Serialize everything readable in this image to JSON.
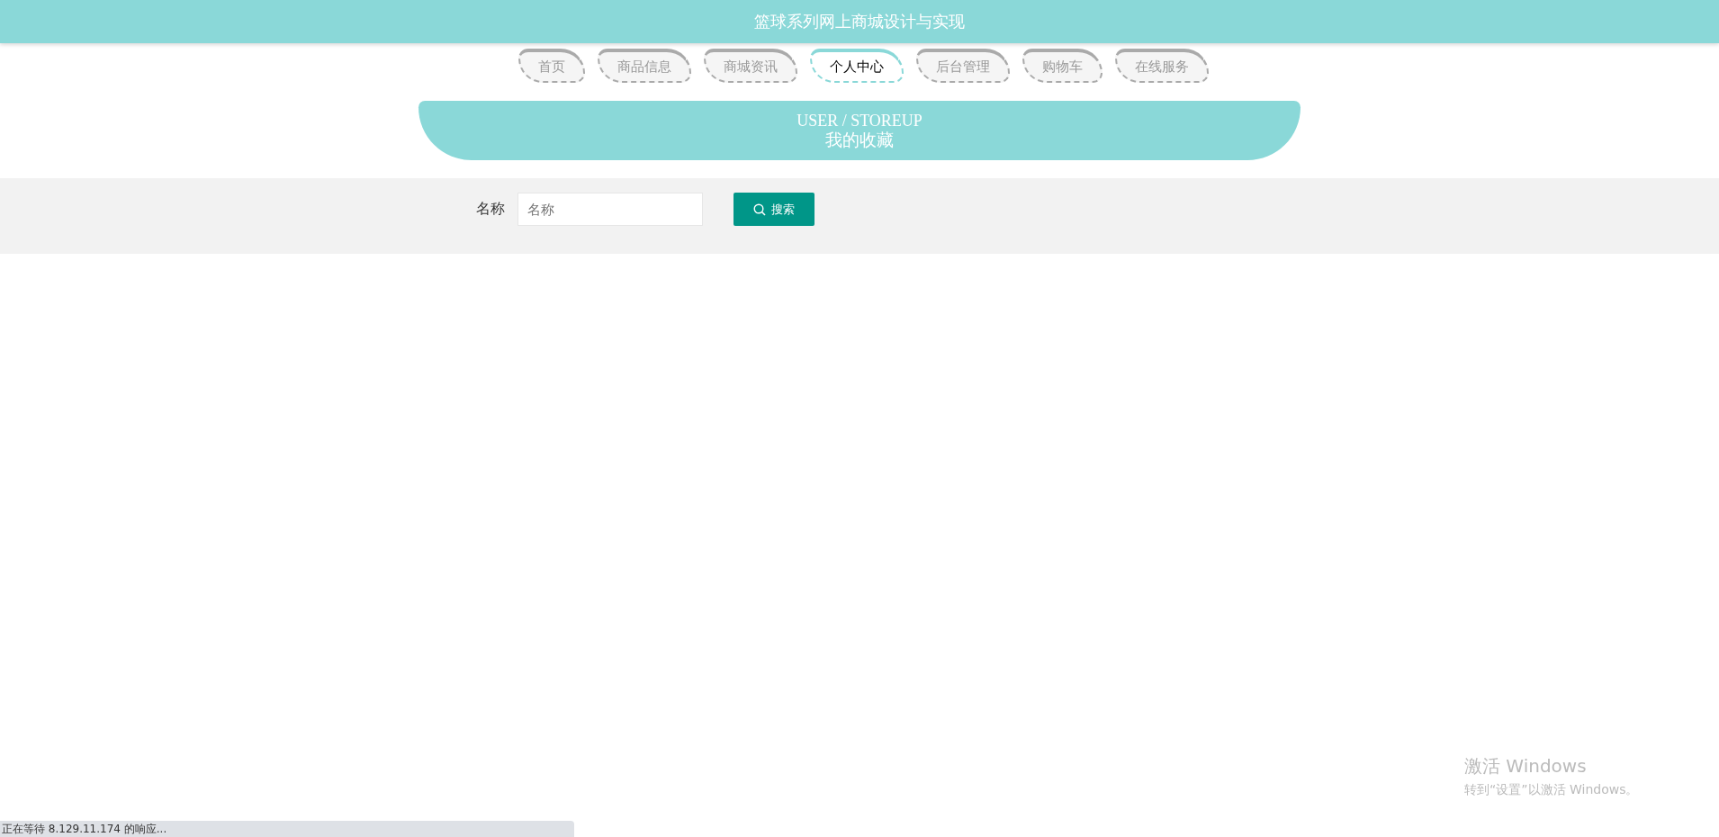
{
  "header": {
    "title": "篮球系列网上商城设计与实现"
  },
  "nav": [
    {
      "label": "首页",
      "selected": false
    },
    {
      "label": "商品信息",
      "selected": false
    },
    {
      "label": "商城资讯",
      "selected": false
    },
    {
      "label": "个人中心",
      "selected": true
    },
    {
      "label": "后台管理",
      "selected": false
    },
    {
      "label": "购物车",
      "selected": false
    },
    {
      "label": "在线服务",
      "selected": false
    }
  ],
  "banner": {
    "subtitle": "USER / STOREUP",
    "title": "我的收藏"
  },
  "search": {
    "label": "名称",
    "placeholder": "名称",
    "button": "搜索"
  },
  "status_bar": {
    "text": "正在等待 8.129.11.174 的响应..."
  },
  "activation_notice": {
    "title": "激活 Windows",
    "text": "转到“设置”以激活 Windows。"
  }
}
